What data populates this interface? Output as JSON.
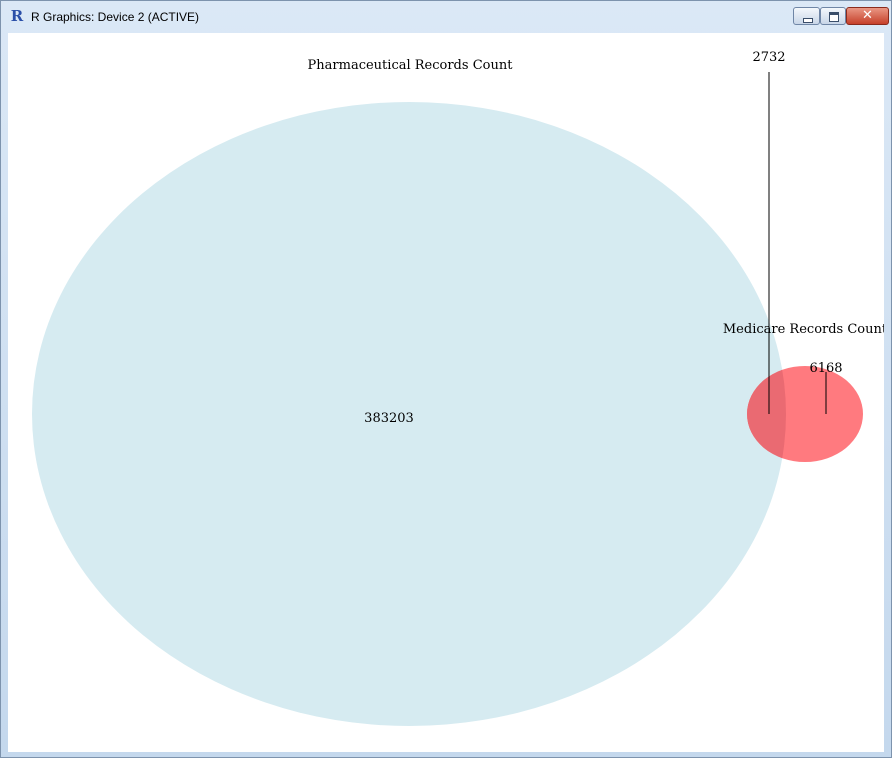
{
  "window": {
    "title": "R Graphics: Device 2 (ACTIVE)",
    "app_icon": "R",
    "controls": {
      "minimize": "minimize-icon",
      "maximize": "maximize-icon",
      "close": "close-icon"
    }
  },
  "venn": {
    "sets": [
      {
        "name": "Pharmaceutical Records Count",
        "only_count": "383203",
        "color": "#d6ebf1"
      },
      {
        "name": "Medicare Records Count",
        "only_count": "6168",
        "color": "#ff7a7f"
      }
    ],
    "intersection_count": "2732",
    "overlap_color": "#ea6a72"
  }
}
